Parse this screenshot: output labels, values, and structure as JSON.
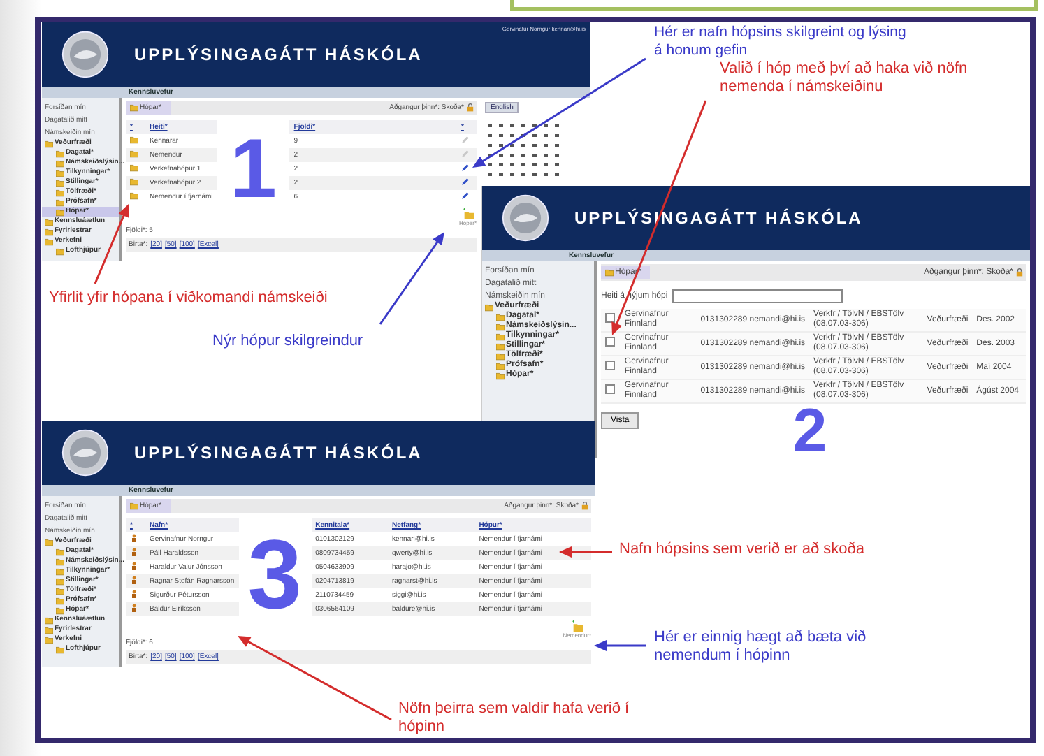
{
  "screens": [
    {
      "kind": "group-list",
      "header": "UPPLÝSINGAGÁTT HÁSKÓLA",
      "user": "Gervinafur Norngur kennari@hi.is",
      "nav": "Kennsluvefur",
      "language_button": "English",
      "sidebar": {
        "links": [
          "Forsíðan mín",
          "Dagatalið mitt",
          "Námskeiðin mín"
        ],
        "tree": [
          {
            "label": "Veðurfræði",
            "selected": false,
            "children": [
              {
                "label": "Dagatal*",
                "selected": false
              },
              {
                "label": "Námskeiðslýsin...",
                "selected": false
              },
              {
                "label": "Tilkynningar*",
                "selected": false
              },
              {
                "label": "Stillingar*",
                "selected": false
              },
              {
                "label": "Tölfræði*",
                "selected": false
              },
              {
                "label": "Prófsafn*",
                "selected": false
              },
              {
                "label": "Hópar*",
                "selected": true
              }
            ]
          },
          {
            "label": "Kennsluáætlun",
            "selected": false
          },
          {
            "label": "Fyrirlestrar",
            "selected": false
          },
          {
            "label": "Verkefni",
            "selected": false,
            "children": [
              {
                "label": "Lofthjúpur",
                "selected": false
              }
            ]
          }
        ]
      },
      "tab": "Hópar*",
      "access": "Aðgangur þinn*: Skoða*",
      "columns": [
        "*",
        "Heiti*",
        "Fjöldi*",
        "*"
      ],
      "rows": [
        {
          "name": "Kennarar",
          "count": "9",
          "editable": false
        },
        {
          "name": "Nemendur",
          "count": "2",
          "editable": false
        },
        {
          "name": "Verkefnahópur 1",
          "count": "2",
          "editable": true
        },
        {
          "name": "Verkefnahópur 2",
          "count": "2",
          "editable": true
        },
        {
          "name": "Nemendur í fjarnámi",
          "count": "6",
          "editable": true
        }
      ],
      "total": "Fjöldi*: 5",
      "show_label": "Birta*:",
      "show_links": [
        "[20]",
        "[50]",
        "[100]",
        "[Excel]"
      ],
      "add_caption": "Hópar*",
      "big_number": "1"
    },
    {
      "kind": "add-members",
      "header": "UPPLÝSINGAGÁTT HÁSKÓLA",
      "nav": "Kennsluvefur",
      "sidebar": {
        "links": [
          "Forsíðan mín",
          "Dagatalið mitt",
          "Námskeiðin mín"
        ],
        "tree": [
          {
            "label": "Veðurfræði",
            "selected": false,
            "children": [
              {
                "label": "Dagatal*",
                "selected": false
              },
              {
                "label": "Námskeiðslýsin...",
                "selected": false
              },
              {
                "label": "Tilkynningar*",
                "selected": false
              },
              {
                "label": "Stillingar*",
                "selected": false
              },
              {
                "label": "Tölfræði*",
                "selected": false
              },
              {
                "label": "Prófsafn*",
                "selected": false
              },
              {
                "label": "Hópar*",
                "selected": false
              }
            ]
          }
        ]
      },
      "tab": "Hópar*",
      "access": "Aðgangur þinn*: Skoða*",
      "name_label": "Heiti á nýjum hópi",
      "rows": [
        {
          "checked": false,
          "name": "Gervinafnur Finnland",
          "contact": "0131302289 nemandi@hi.is",
          "program": "Verkfr / TölvN / EBSTölv (08.07.03-306)",
          "department": "Veðurfræði",
          "term": "Des. 2002"
        },
        {
          "checked": false,
          "name": "Gervinafnur Finnland",
          "contact": "0131302289 nemandi@hi.is",
          "program": "Verkfr / TölvN / EBSTölv (08.07.03-306)",
          "department": "Veðurfræði",
          "term": "Des. 2003"
        },
        {
          "checked": false,
          "name": "Gervinafnur Finnland",
          "contact": "0131302289 nemandi@hi.is",
          "program": "Verkfr / TölvN / EBSTölv (08.07.03-306)",
          "department": "Veðurfræði",
          "term": "Maí 2004"
        },
        {
          "checked": false,
          "name": "Gervinafnur Finnland",
          "contact": "0131302289 nemandi@hi.is",
          "program": "Verkfr / TölvN / EBSTölv (08.07.03-306)",
          "department": "Veðurfræði",
          "term": "Ágúst 2004"
        }
      ],
      "save_button": "Vista",
      "big_number": "2"
    },
    {
      "kind": "members",
      "header": "UPPLÝSINGAGÁTT HÁSKÓLA",
      "nav": "Kennsluvefur",
      "sidebar": {
        "links": [
          "Forsíðan mín",
          "Dagatalið mitt",
          "Námskeiðin mín"
        ],
        "tree": [
          {
            "label": "Veðurfræði",
            "selected": false,
            "children": [
              {
                "label": "Dagatal*",
                "selected": false
              },
              {
                "label": "Námskeiðslýsin...",
                "selected": false
              },
              {
                "label": "Tilkynningar*",
                "selected": false
              },
              {
                "label": "Stillingar*",
                "selected": false
              },
              {
                "label": "Tölfræði*",
                "selected": false
              },
              {
                "label": "Prófsafn*",
                "selected": false
              },
              {
                "label": "Hópar*",
                "selected": false
              }
            ]
          },
          {
            "label": "Kennsluáætlun",
            "selected": false
          },
          {
            "label": "Fyrirlestrar",
            "selected": false
          },
          {
            "label": "Verkefni",
            "selected": false,
            "children": [
              {
                "label": "Lofthjúpur",
                "selected": false
              }
            ]
          }
        ]
      },
      "tab": "Hópar*",
      "access": "Aðgangur þinn*: Skoða*",
      "columns": [
        "*",
        "Nafn*",
        "Kennitala*",
        "Netfang*",
        "Hópur*"
      ],
      "rows": [
        {
          "name": "Gervinafnur Norngur",
          "id": "0101302129",
          "email": "kennari@hi.is",
          "group": "Nemendur í fjarnámi"
        },
        {
          "name": "Páll Haraldsson",
          "id": "0809734459",
          "email": "qwerty@hi.is",
          "group": "Nemendur í fjarnámi"
        },
        {
          "name": "Haraldur Valur Jónsson",
          "id": "0504633909",
          "email": "harajo@hi.is",
          "group": "Nemendur í fjarnámi"
        },
        {
          "name": "Ragnar Stefán Ragnarsson",
          "id": "0204713819",
          "email": "ragnarst@hi.is",
          "group": "Nemendur í fjarnámi"
        },
        {
          "name": "Sigurður Pétursson",
          "id": "2110734459",
          "email": "siggi@hi.is",
          "group": "Nemendur í fjarnámi"
        },
        {
          "name": "Baldur Eiríksson",
          "id": "0306564109",
          "email": "baldure@hi.is",
          "group": "Nemendur í fjarnámi"
        }
      ],
      "total": "Fjöldi*: 6",
      "show_label": "Birta*:",
      "show_links": [
        "[20]",
        "[50]",
        "[100]",
        "[Excel]"
      ],
      "add_caption": "Nemendur*",
      "big_number": "3"
    }
  ],
  "annotations": [
    {
      "text": "Hér er nafn hópsins skilgreint og lýsing á honum gefin",
      "color": "#3a3ac8"
    },
    {
      "text": "Valið í hóp með því að haka við nöfn nemenda í námskeiðinu",
      "color": "#d42c2c"
    },
    {
      "text": "Yfirlit yfir hópana í viðkomandi námskeiði",
      "color": "#d42c2c"
    },
    {
      "text": "Nýr hópur skilgreindur",
      "color": "#3a3ac8"
    },
    {
      "text": "Nafn hópsins sem verið er að skoða",
      "color": "#d42c2c"
    },
    {
      "text": "Hér er einnig hægt að bæta við nemendum í hópinn",
      "color": "#3a3ac8"
    },
    {
      "text": "Nöfn þeirra sem valdir hafa verið í hópinn",
      "color": "#d42c2c"
    }
  ]
}
